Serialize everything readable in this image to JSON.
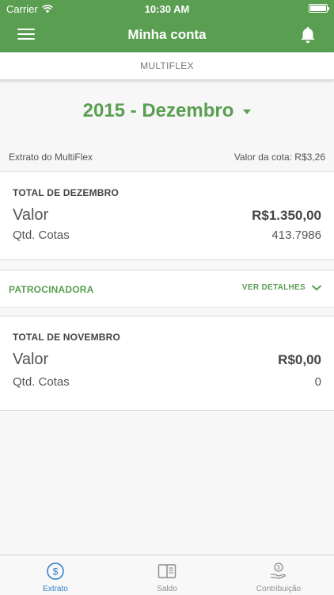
{
  "status": {
    "carrier": "Carrier",
    "time": "10:30 AM"
  },
  "nav": {
    "title": "Minha conta"
  },
  "subtab": {
    "label": "MULTIFLEX"
  },
  "period": {
    "label": "2015 - Dezembro"
  },
  "meta": {
    "extract_label": "Extrato do MultiFlex",
    "quota_value": "Valor da cota: R$3,26"
  },
  "december": {
    "heading": "TOTAL DE DEZEMBRO",
    "valor_label": "Valor",
    "valor": "R$1.350,00",
    "cotas_label": "Qtd. Cotas",
    "cotas": "413.7986"
  },
  "sponsor": {
    "label": "PATROCINADORA",
    "details_label": "VER DETALHES"
  },
  "november": {
    "heading": "TOTAL DE NOVEMBRO",
    "valor_label": "Valor",
    "valor": "R$0,00",
    "cotas_label": "Qtd. Cotas",
    "cotas": "0"
  },
  "tabs": [
    {
      "label": "Extrato",
      "icon": "dollar-circle-icon",
      "active": true
    },
    {
      "label": "Saldo",
      "icon": "book-icon",
      "active": false
    },
    {
      "label": "Contribuição",
      "icon": "hand-coin-icon",
      "active": false
    }
  ],
  "colors": {
    "brand": "#5a9e52",
    "active_tab": "#2f7ec7",
    "inactive_tab": "#8e8e8e"
  }
}
